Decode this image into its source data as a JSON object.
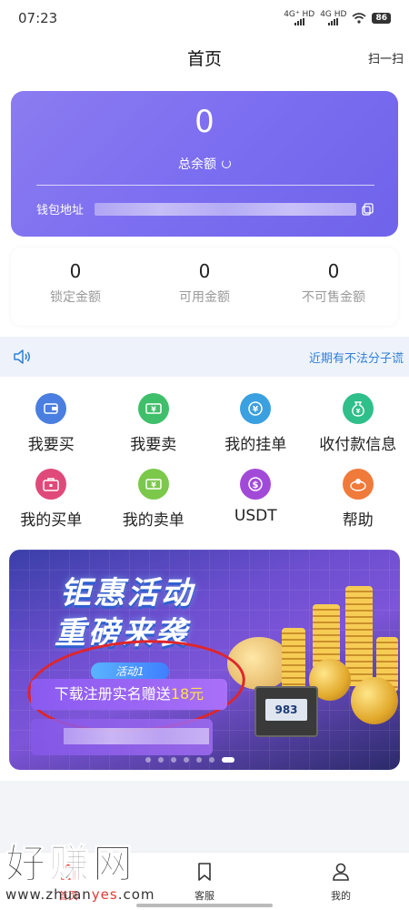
{
  "status": {
    "time": "07:23",
    "signal1": "4G⁺ HD",
    "signal2": "4G HD",
    "battery": "86"
  },
  "header": {
    "title": "首页",
    "scan_label": "扫一扫"
  },
  "balance": {
    "amount": "0",
    "label": "总余额",
    "wallet_label": "钱包地址"
  },
  "stats": [
    {
      "value": "0",
      "label": "锁定金额"
    },
    {
      "value": "0",
      "label": "可用金额"
    },
    {
      "value": "0",
      "label": "不可售金额"
    }
  ],
  "notice": {
    "text": "近期有不法分子谎"
  },
  "menu": [
    {
      "label": "我要买",
      "icon": "wallet-icon",
      "color": "#4a7ee0"
    },
    {
      "label": "我要卖",
      "icon": "cash-icon",
      "color": "#3fbf6a"
    },
    {
      "label": "我的挂单",
      "icon": "exchange-icon",
      "color": "#3aa0e0"
    },
    {
      "label": "收付款信息",
      "icon": "money-bag-icon",
      "color": "#2fbf8a"
    },
    {
      "label": "我的买单",
      "icon": "briefcase-icon",
      "color": "#e04a7a"
    },
    {
      "label": "我的卖单",
      "icon": "ticket-icon",
      "color": "#7bc84a"
    },
    {
      "label": "USDT",
      "icon": "dollar-icon",
      "color": "#a24ad8"
    },
    {
      "label": "帮助",
      "icon": "help-icon",
      "color": "#f07a3a"
    }
  ],
  "banner": {
    "title_line1": "钜惠活动",
    "title_line2": "重磅来袭",
    "activity_tag": "活动1",
    "activity_text": "下载注册实名赠送",
    "activity_amount": "18元",
    "safe_label": "983"
  },
  "tabs": [
    {
      "label": "首页",
      "icon": "home-icon",
      "active": true
    },
    {
      "label": "客服",
      "icon": "bookmark-icon",
      "active": false
    },
    {
      "label": "我的",
      "icon": "user-icon",
      "active": false
    }
  ],
  "watermark": {
    "big": "好赚网",
    "url_part1": "www.zhuan",
    "url_part2": "yes",
    "url_part3": ".com"
  },
  "colors": {
    "card_gradient_start": "#8b7cf0",
    "card_gradient_end": "#6f63ea",
    "notice_text": "#2f7fd8",
    "active_tab": "#e53935"
  }
}
